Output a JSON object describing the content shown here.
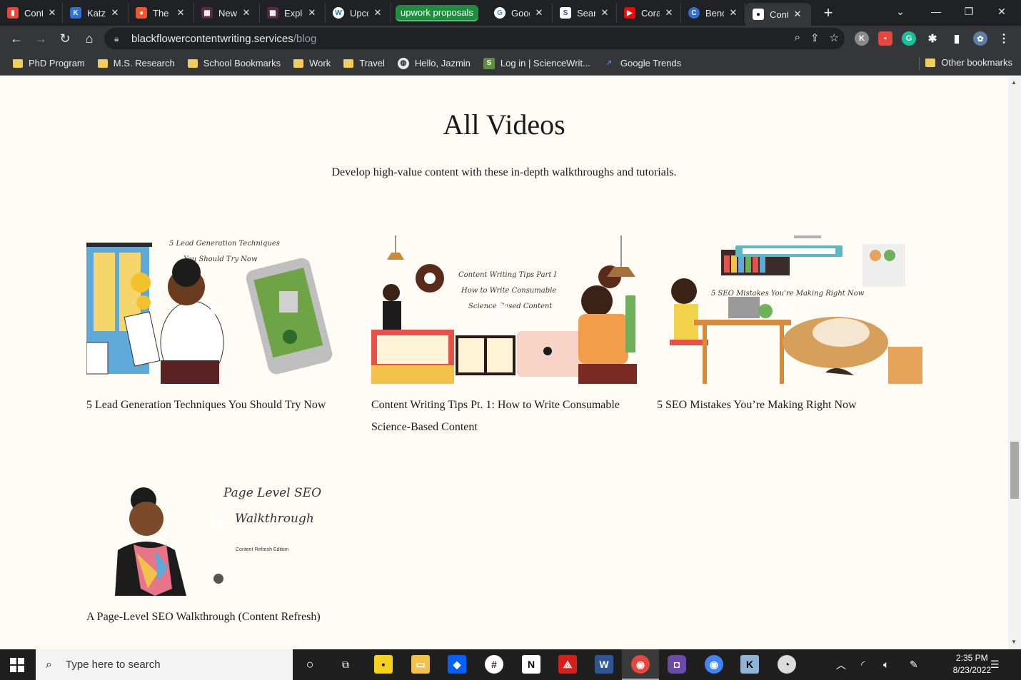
{
  "browser": {
    "tabs": [
      {
        "title": "Content",
        "icon": "analytics-icon",
        "color": "#e8453c"
      },
      {
        "title": "Katz",
        "icon": "app-icon",
        "color": "#2f6fd6"
      },
      {
        "title": "The",
        "icon": "paw-icon",
        "color": "#f2542d"
      },
      {
        "title": "New",
        "icon": "calendar-icon",
        "color": "#5a2b44"
      },
      {
        "title": "Explore",
        "icon": "calendar-icon",
        "color": "#5a2b44"
      },
      {
        "title": "Upcoming",
        "icon": "wordpress-icon",
        "color": "#ffffff"
      },
      {
        "title": "Google",
        "icon": "google-icon",
        "color": "#ffffff"
      },
      {
        "title": "Search",
        "icon": "s-icon",
        "color": "#ffffff"
      },
      {
        "title": "Cora",
        "icon": "youtube-icon",
        "color": "#ff0000"
      },
      {
        "title": "Bend",
        "icon": "c-icon",
        "color": "#2f6fd6"
      },
      {
        "title": "Content",
        "icon": "page-icon",
        "color": "#ffffff",
        "active": true
      }
    ],
    "tab_group_label": "upwork proposals",
    "url_host": "blackflowercontentwriting.services",
    "url_path": "/blog",
    "bookmarks": [
      {
        "label": "PhD Program",
        "type": "folder"
      },
      {
        "label": "M.S. Research",
        "type": "folder"
      },
      {
        "label": "School Bookmarks",
        "type": "folder"
      },
      {
        "label": "Work",
        "type": "folder"
      },
      {
        "label": "Travel",
        "type": "folder"
      },
      {
        "label": "Hello, Jazmin",
        "type": "globe"
      },
      {
        "label": "Log in | ScienceWrit...",
        "type": "site"
      },
      {
        "label": "Google Trends",
        "type": "trends"
      }
    ],
    "other_bookmarks": "Other bookmarks",
    "profile_initial": "K"
  },
  "page": {
    "title": "All Videos",
    "subtitle": "Develop high-value content with these in-depth walkthroughs and tutorials.",
    "videos": [
      {
        "title": "5 Lead Generation Techniques You Should Try Now",
        "thumb_text_1": "5 Lead Generation Techniques",
        "thumb_text_2": "You Should Try Now"
      },
      {
        "title": "Content Writing Tips Pt. 1: How to Write Consumable Science-Based Content",
        "thumb_text_1": "Content Writing Tips Part I",
        "thumb_text_2": "How to Write Consumable",
        "thumb_text_3": "Science-Based Content"
      },
      {
        "title": "5 SEO Mistakes You’re Making Right Now",
        "thumb_text_1": "5 SEO Mistakes You're Making Right Now"
      },
      {
        "title": "A Page-Level SEO Walkthrough (Content Refresh)",
        "thumb_text_1": "Page Level SEO",
        "thumb_text_2": "Walkthrough",
        "thumb_text_3": "Content Refresh Edition"
      }
    ]
  },
  "taskbar": {
    "search_placeholder": "Type here to search",
    "time": "2:35 PM",
    "date": "8/23/2022"
  }
}
